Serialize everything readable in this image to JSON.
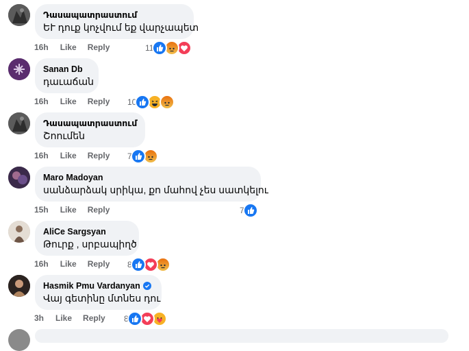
{
  "comments": [
    {
      "author": "Դասապատրաստում",
      "text": "ԵՒ դուք կոչվում եք վարչապետ",
      "time": "16h",
      "like_label": "Like",
      "reply_label": "Reply",
      "reaction_count": "11",
      "reactions": [
        "like",
        "angry",
        "love"
      ],
      "avatar_color": "#4a4a4a"
    },
    {
      "author": "Sanan Db",
      "text": "դաւաճան",
      "time": "16h",
      "like_label": "Like",
      "reply_label": "Reply",
      "reaction_count": "10",
      "reactions": [
        "like",
        "haha",
        "angry"
      ],
      "avatar_color": "#5a2d6e"
    },
    {
      "author": "Դասապատրաստում",
      "text": "Շոումեն",
      "time": "16h",
      "like_label": "Like",
      "reply_label": "Reply",
      "reaction_count": "7",
      "reactions": [
        "like",
        "angry"
      ],
      "avatar_color": "#4a4a4a"
    },
    {
      "author": "Maro Madoyan",
      "text": "սանձարձակ սրիկա, քո մահով չես սատկելու",
      "time": "15h",
      "like_label": "Like",
      "reply_label": "Reply",
      "reaction_count": "7",
      "reactions": [
        "like"
      ],
      "avatar_color": "#3b2a4a"
    },
    {
      "author": "AliCe Sargsyan",
      "text": "Թուրք , սրբապիղծ",
      "time": "16h",
      "like_label": "Like",
      "reply_label": "Reply",
      "reaction_count": "8",
      "reactions": [
        "like",
        "love",
        "angry"
      ],
      "avatar_color": "#c7b8a8"
    },
    {
      "author": "Hasmik Pmu Vardanyan",
      "text": "Վայ գետինը մտնես դու",
      "time": "3h",
      "like_label": "Like",
      "reply_label": "Reply",
      "reaction_count": "8",
      "reactions": [
        "like",
        "love",
        "care"
      ],
      "verified": true,
      "avatar_color": "#2b2320"
    }
  ],
  "colors": {
    "bubble": "#f0f2f5",
    "meta_text": "#65676b",
    "like_blue": "#1877f2",
    "love_red": "#f33e58",
    "angry_orange": "#e9710f"
  }
}
